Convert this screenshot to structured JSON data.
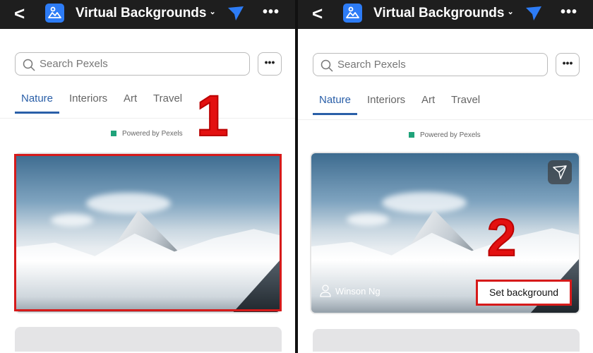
{
  "header": {
    "title": "Virtual Backgrounds"
  },
  "search": {
    "placeholder": "Search Pexels"
  },
  "more_label": "•••",
  "tabs": [
    {
      "label": "Nature",
      "active": true
    },
    {
      "label": "Interiors"
    },
    {
      "label": "Art"
    },
    {
      "label": "Travel"
    }
  ],
  "powered_by": "Powered by Pexels",
  "card": {
    "author": "Winson Ng",
    "set_background_label": "Set background"
  },
  "annotations": {
    "step1": "1",
    "step2": "2",
    "highlight_color": "#d61a1a"
  },
  "colors": {
    "accent": "#2a5fa8",
    "app_icon": "#2d7cf6",
    "header_bg": "#1e1e1e"
  }
}
